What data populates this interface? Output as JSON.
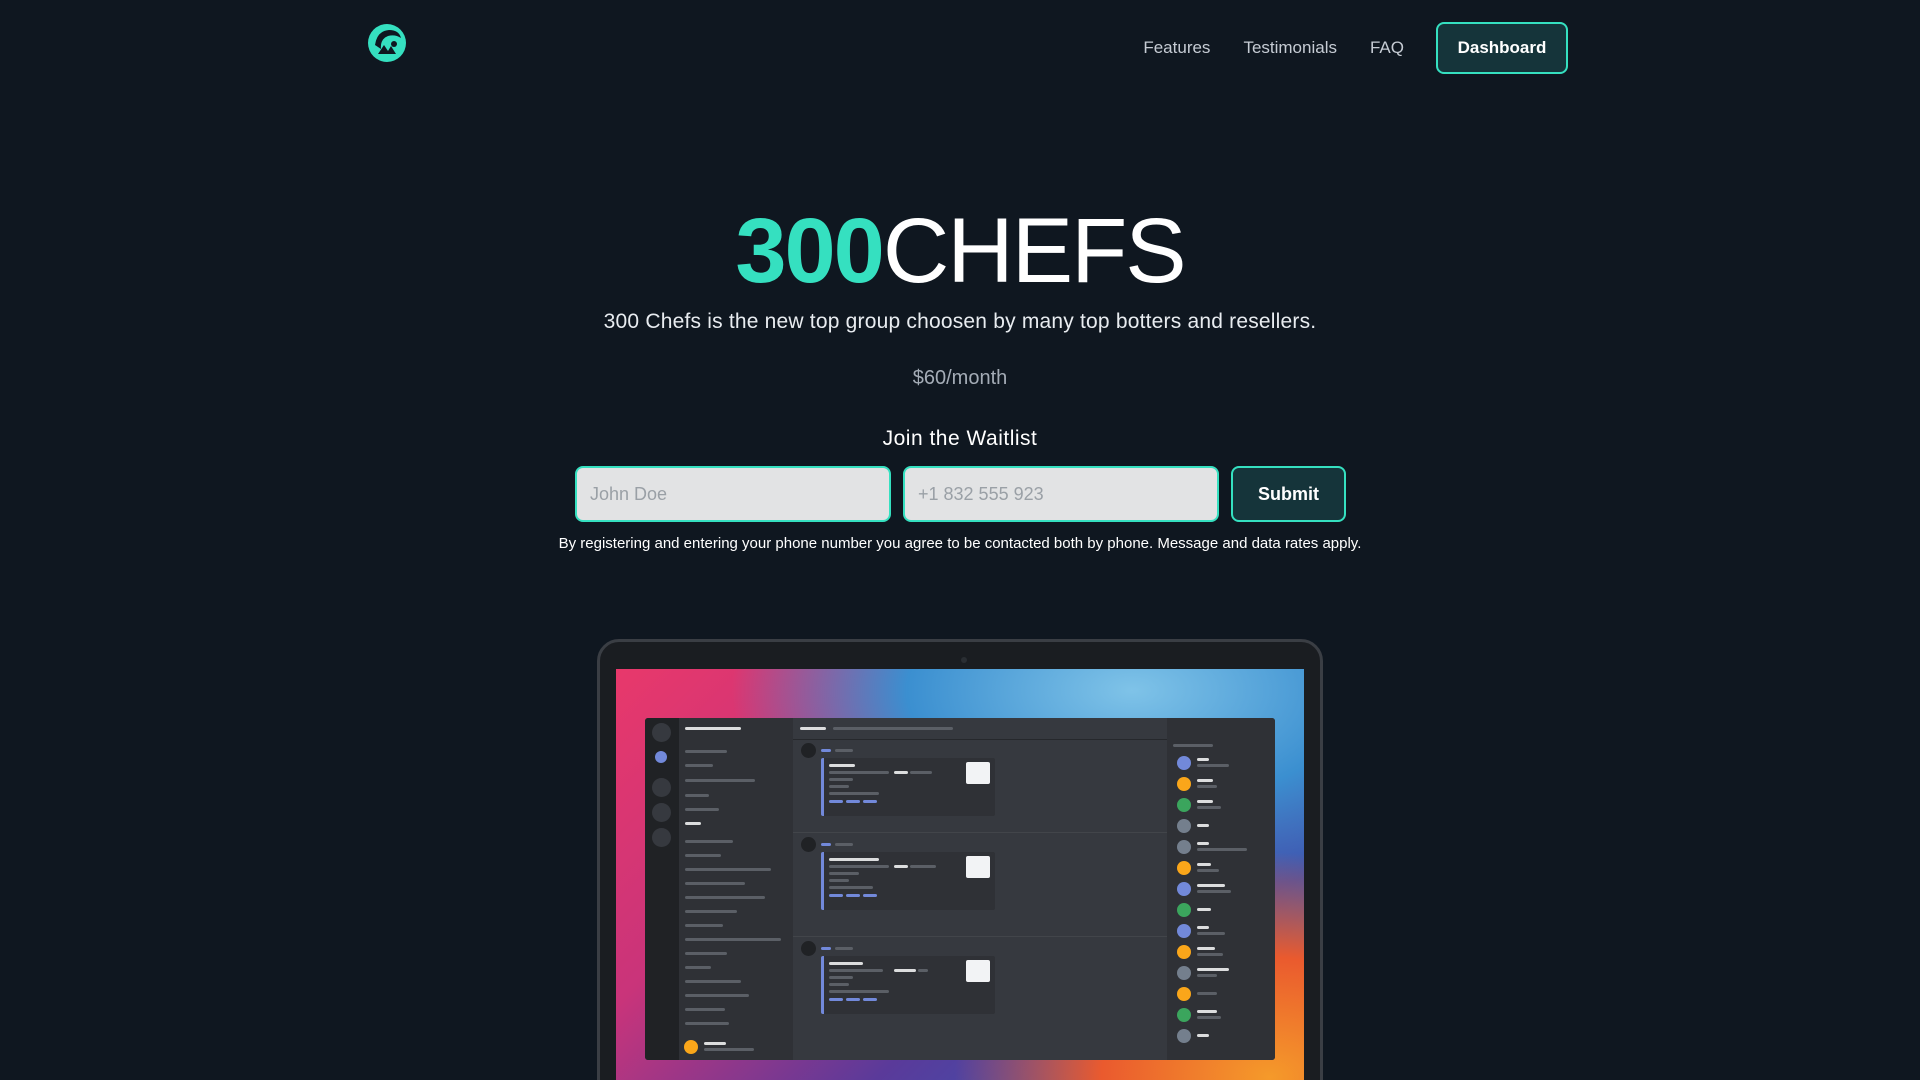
{
  "brand": {
    "logo_icon": "chef-hat-logo-icon",
    "accent_color": "#35e0c0",
    "background_color": "#0f1720"
  },
  "nav": {
    "links": [
      "Features",
      "Testimonials",
      "FAQ"
    ],
    "dashboard_label": "Dashboard"
  },
  "hero": {
    "title_accent": "300",
    "title_rest": "CHEFS",
    "subtitle": "300 Chefs is the new top group choosen by many top botters and resellers.",
    "price": "$60/month"
  },
  "waitlist": {
    "title": "Join the Waitlist",
    "name_placeholder": "John Doe",
    "phone_placeholder": "+1 832 555 923",
    "submit_label": "Submit",
    "disclaimer": "By registering and entering your phone number you agree to be contacted both by phone. Message and data rates apply."
  },
  "mockup": {
    "device": "laptop",
    "screen_app": "discord-style chat app",
    "member_status_colors": [
      "#7289da",
      "#faa61a",
      "#3ba55d",
      "#747f8d"
    ]
  }
}
